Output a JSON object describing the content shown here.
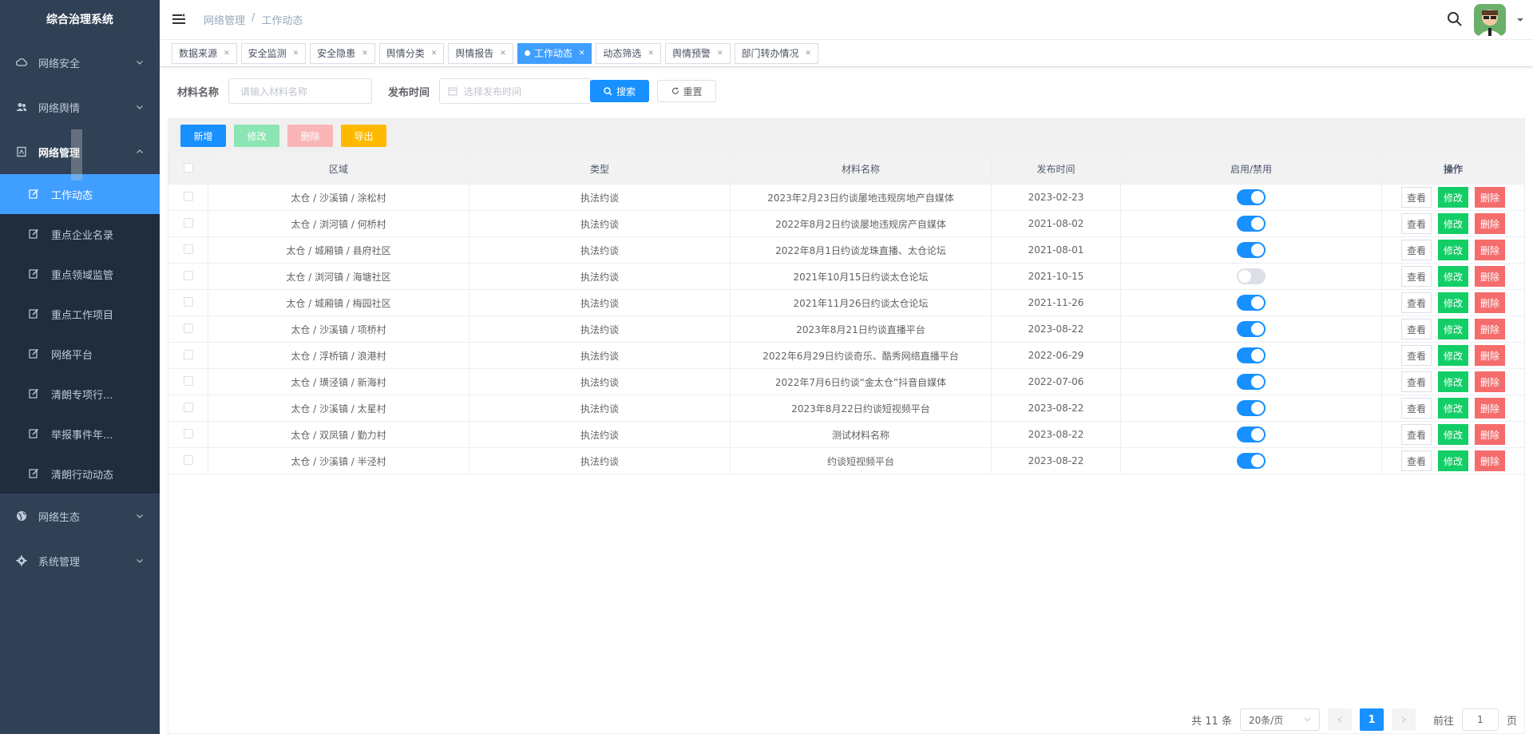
{
  "app": {
    "title": "综合治理系统"
  },
  "sidebar": {
    "menus_top": [
      {
        "label": "网络安全",
        "icon": "cloud-icon"
      },
      {
        "label": "网络舆情",
        "icon": "users-icon"
      },
      {
        "label": "网络管理",
        "icon": "tablet-icon"
      }
    ],
    "submenu": [
      {
        "label": "工作动态",
        "active": true
      },
      {
        "label": "重点企业名录"
      },
      {
        "label": "重点领域监管"
      },
      {
        "label": "重点工作项目"
      },
      {
        "label": "网络平台"
      },
      {
        "label": "清朗专项行..."
      },
      {
        "label": "举报事件年..."
      },
      {
        "label": "清朗行动动态"
      }
    ],
    "menus_bottom": [
      {
        "label": "网络生态",
        "icon": "globe-icon"
      },
      {
        "label": "系统管理",
        "icon": "gear-icon"
      }
    ]
  },
  "breadcrumb": {
    "parent": "网络管理",
    "sep": "/",
    "current": "工作动态"
  },
  "tags": [
    {
      "label": "数据来源"
    },
    {
      "label": "安全监测"
    },
    {
      "label": "安全隐患"
    },
    {
      "label": "舆情分类"
    },
    {
      "label": "舆情报告"
    },
    {
      "label": "工作动态",
      "active": true
    },
    {
      "label": "动态筛选"
    },
    {
      "label": "舆情预警"
    },
    {
      "label": "部门转办情况"
    }
  ],
  "search": {
    "name_label": "材料名称",
    "name_placeholder": "请输入材料名称",
    "date_label": "发布时间",
    "date_placeholder": "选择发布时间",
    "search_btn": "搜索",
    "reset_btn": "重置"
  },
  "toolbar": {
    "add": "新增",
    "edit": "修改",
    "delete": "删除",
    "export": "导出",
    "colors": {
      "add": "#1890ff",
      "edit": "#8ce6b3",
      "delete": "#fab6b6",
      "export": "#ffba00"
    }
  },
  "table": {
    "headers": [
      "区域",
      "类型",
      "材料名称",
      "发布时间",
      "启用/禁用",
      "操作"
    ],
    "rows": [
      {
        "region": "太仓 / 沙溪镇 / 涂松村",
        "type": "执法约谈",
        "name": "2023年2月23日约谈屡地违规房地产自媒体",
        "date": "2023-02-23",
        "enabled": true
      },
      {
        "region": "太仓 / 浏河镇 / 何桥村",
        "type": "执法约谈",
        "name": "2022年8月2日约谈屡地违规房产自媒体",
        "date": "2021-08-02",
        "enabled": true
      },
      {
        "region": "太仓 / 城厢镇 / 县府社区",
        "type": "执法约谈",
        "name": "2022年8月1日约谈龙珠直播、太仓论坛",
        "date": "2021-08-01",
        "enabled": true
      },
      {
        "region": "太仓 / 浏河镇 / 海塘社区",
        "type": "执法约谈",
        "name": "2021年10月15日约谈太仓论坛",
        "date": "2021-10-15",
        "enabled": false
      },
      {
        "region": "太仓 / 城厢镇 / 梅园社区",
        "type": "执法约谈",
        "name": "2021年11月26日约谈太仓论坛",
        "date": "2021-11-26",
        "enabled": true
      },
      {
        "region": "太仓 / 沙溪镇 / 项桥村",
        "type": "执法约谈",
        "name": "2023年8月21日约谈直播平台",
        "date": "2023-08-22",
        "enabled": true
      },
      {
        "region": "太仓 / 浮桥镇 / 浪港村",
        "type": "执法约谈",
        "name": "2022年6月29日约谈奇乐、酷秀网络直播平台",
        "date": "2022-06-29",
        "enabled": true
      },
      {
        "region": "太仓 / 璜泾镇 / 新海村",
        "type": "执法约谈",
        "name": "2022年7月6日约谈“金太仓”抖音自媒体",
        "date": "2022-07-06",
        "enabled": true
      },
      {
        "region": "太仓 / 沙溪镇 / 太星村",
        "type": "执法约谈",
        "name": "2023年8月22日约谈短视频平台",
        "date": "2023-08-22",
        "enabled": true
      },
      {
        "region": "太仓 / 双凤镇 / 勤力村",
        "type": "执法约谈",
        "name": "测试材料名称",
        "date": "2023-08-22",
        "enabled": true
      },
      {
        "region": "太仓 / 沙溪镇 / 半泾村",
        "type": "执法约谈",
        "name": "约谈短视频平台",
        "date": "2023-08-22",
        "enabled": true
      }
    ],
    "ops": {
      "view": "查看",
      "edit": "修改",
      "delete": "删除"
    }
  },
  "pagination": {
    "total": "共 11 条",
    "page_size": "20条/页",
    "current": "1",
    "goto_prefix": "前往",
    "goto_value": "1",
    "goto_suffix": "页"
  }
}
